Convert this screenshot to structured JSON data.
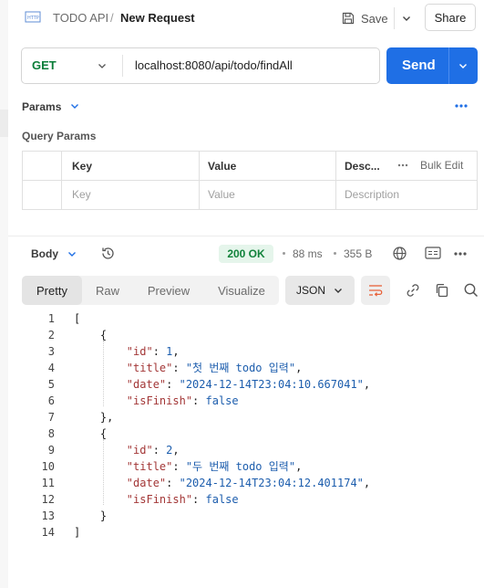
{
  "header": {
    "collection": "TODO API",
    "separator": "/",
    "title": "New Request",
    "save_label": "Save",
    "share_label": "Share"
  },
  "request": {
    "method": "GET",
    "url": "localhost:8080/api/todo/findAll",
    "send_label": "Send"
  },
  "params": {
    "tab_label": "Params",
    "section_label": "Query Params",
    "columns": [
      "Key",
      "Value",
      "Desc..."
    ],
    "bulk_edit": "Bulk Edit",
    "placeholders": {
      "key": "Key",
      "value": "Value",
      "description": "Description"
    }
  },
  "response": {
    "body_label": "Body",
    "status": "200 OK",
    "time": "88 ms",
    "size": "355 B",
    "view_tabs": [
      "Pretty",
      "Raw",
      "Preview",
      "Visualize"
    ],
    "active_tab": "Pretty",
    "format": "JSON"
  },
  "code_lines": [
    {
      "n": "1",
      "text": "["
    },
    {
      "n": "2",
      "text": "    {"
    },
    {
      "n": "3",
      "text": "        \"id\": 1,"
    },
    {
      "n": "4",
      "text": "        \"title\": \"첫 번째 todo 입력\","
    },
    {
      "n": "5",
      "text": "        \"date\": \"2024-12-14T23:04:10.667041\","
    },
    {
      "n": "6",
      "text": "        \"isFinish\": false"
    },
    {
      "n": "7",
      "text": "    },"
    },
    {
      "n": "8",
      "text": "    {"
    },
    {
      "n": "9",
      "text": "        \"id\": 2,"
    },
    {
      "n": "10",
      "text": "        \"title\": \"두 번째 todo 입력\","
    },
    {
      "n": "11",
      "text": "        \"date\": \"2024-12-14T23:04:12.401174\","
    },
    {
      "n": "12",
      "text": "        \"isFinish\": false"
    },
    {
      "n": "13",
      "text": "    }"
    },
    {
      "n": "14",
      "text": "]"
    }
  ],
  "colors": {
    "send": "#1f6fe5",
    "method": "#0a7d38",
    "status_bg": "#e5f5eb",
    "status_text": "#11823b",
    "json_key": "#a33737",
    "json_value": "#1c5dad",
    "bulk_edit_icon": "#1f6fe5"
  },
  "icons": [
    "http-icon",
    "save-icon",
    "chevron-down-icon",
    "history-icon",
    "globe-icon",
    "save-response-icon",
    "more-icon",
    "wrap-icon",
    "link-icon",
    "copy-icon",
    "search-icon"
  ]
}
